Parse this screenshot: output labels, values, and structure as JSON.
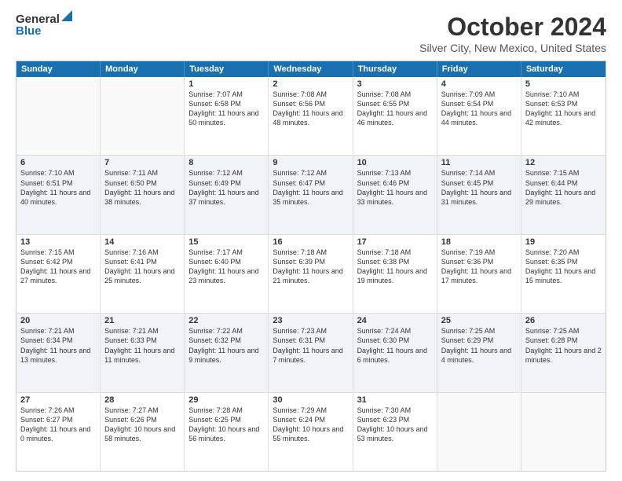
{
  "header": {
    "logo_general": "General",
    "logo_blue": "Blue",
    "month": "October 2024",
    "location": "Silver City, New Mexico, United States"
  },
  "days_of_week": [
    "Sunday",
    "Monday",
    "Tuesday",
    "Wednesday",
    "Thursday",
    "Friday",
    "Saturday"
  ],
  "rows": [
    [
      {
        "day": "",
        "text": ""
      },
      {
        "day": "",
        "text": ""
      },
      {
        "day": "1",
        "text": "Sunrise: 7:07 AM\nSunset: 6:58 PM\nDaylight: 11 hours and 50 minutes."
      },
      {
        "day": "2",
        "text": "Sunrise: 7:08 AM\nSunset: 6:56 PM\nDaylight: 11 hours and 48 minutes."
      },
      {
        "day": "3",
        "text": "Sunrise: 7:08 AM\nSunset: 6:55 PM\nDaylight: 11 hours and 46 minutes."
      },
      {
        "day": "4",
        "text": "Sunrise: 7:09 AM\nSunset: 6:54 PM\nDaylight: 11 hours and 44 minutes."
      },
      {
        "day": "5",
        "text": "Sunrise: 7:10 AM\nSunset: 6:53 PM\nDaylight: 11 hours and 42 minutes."
      }
    ],
    [
      {
        "day": "6",
        "text": "Sunrise: 7:10 AM\nSunset: 6:51 PM\nDaylight: 11 hours and 40 minutes."
      },
      {
        "day": "7",
        "text": "Sunrise: 7:11 AM\nSunset: 6:50 PM\nDaylight: 11 hours and 38 minutes."
      },
      {
        "day": "8",
        "text": "Sunrise: 7:12 AM\nSunset: 6:49 PM\nDaylight: 11 hours and 37 minutes."
      },
      {
        "day": "9",
        "text": "Sunrise: 7:12 AM\nSunset: 6:47 PM\nDaylight: 11 hours and 35 minutes."
      },
      {
        "day": "10",
        "text": "Sunrise: 7:13 AM\nSunset: 6:46 PM\nDaylight: 11 hours and 33 minutes."
      },
      {
        "day": "11",
        "text": "Sunrise: 7:14 AM\nSunset: 6:45 PM\nDaylight: 11 hours and 31 minutes."
      },
      {
        "day": "12",
        "text": "Sunrise: 7:15 AM\nSunset: 6:44 PM\nDaylight: 11 hours and 29 minutes."
      }
    ],
    [
      {
        "day": "13",
        "text": "Sunrise: 7:15 AM\nSunset: 6:42 PM\nDaylight: 11 hours and 27 minutes."
      },
      {
        "day": "14",
        "text": "Sunrise: 7:16 AM\nSunset: 6:41 PM\nDaylight: 11 hours and 25 minutes."
      },
      {
        "day": "15",
        "text": "Sunrise: 7:17 AM\nSunset: 6:40 PM\nDaylight: 11 hours and 23 minutes."
      },
      {
        "day": "16",
        "text": "Sunrise: 7:18 AM\nSunset: 6:39 PM\nDaylight: 11 hours and 21 minutes."
      },
      {
        "day": "17",
        "text": "Sunrise: 7:18 AM\nSunset: 6:38 PM\nDaylight: 11 hours and 19 minutes."
      },
      {
        "day": "18",
        "text": "Sunrise: 7:19 AM\nSunset: 6:36 PM\nDaylight: 11 hours and 17 minutes."
      },
      {
        "day": "19",
        "text": "Sunrise: 7:20 AM\nSunset: 6:35 PM\nDaylight: 11 hours and 15 minutes."
      }
    ],
    [
      {
        "day": "20",
        "text": "Sunrise: 7:21 AM\nSunset: 6:34 PM\nDaylight: 11 hours and 13 minutes."
      },
      {
        "day": "21",
        "text": "Sunrise: 7:21 AM\nSunset: 6:33 PM\nDaylight: 11 hours and 11 minutes."
      },
      {
        "day": "22",
        "text": "Sunrise: 7:22 AM\nSunset: 6:32 PM\nDaylight: 11 hours and 9 minutes."
      },
      {
        "day": "23",
        "text": "Sunrise: 7:23 AM\nSunset: 6:31 PM\nDaylight: 11 hours and 7 minutes."
      },
      {
        "day": "24",
        "text": "Sunrise: 7:24 AM\nSunset: 6:30 PM\nDaylight: 11 hours and 6 minutes."
      },
      {
        "day": "25",
        "text": "Sunrise: 7:25 AM\nSunset: 6:29 PM\nDaylight: 11 hours and 4 minutes."
      },
      {
        "day": "26",
        "text": "Sunrise: 7:25 AM\nSunset: 6:28 PM\nDaylight: 11 hours and 2 minutes."
      }
    ],
    [
      {
        "day": "27",
        "text": "Sunrise: 7:26 AM\nSunset: 6:27 PM\nDaylight: 11 hours and 0 minutes."
      },
      {
        "day": "28",
        "text": "Sunrise: 7:27 AM\nSunset: 6:26 PM\nDaylight: 10 hours and 58 minutes."
      },
      {
        "day": "29",
        "text": "Sunrise: 7:28 AM\nSunset: 6:25 PM\nDaylight: 10 hours and 56 minutes."
      },
      {
        "day": "30",
        "text": "Sunrise: 7:29 AM\nSunset: 6:24 PM\nDaylight: 10 hours and 55 minutes."
      },
      {
        "day": "31",
        "text": "Sunrise: 7:30 AM\nSunset: 6:23 PM\nDaylight: 10 hours and 53 minutes."
      },
      {
        "day": "",
        "text": ""
      },
      {
        "day": "",
        "text": ""
      }
    ]
  ]
}
